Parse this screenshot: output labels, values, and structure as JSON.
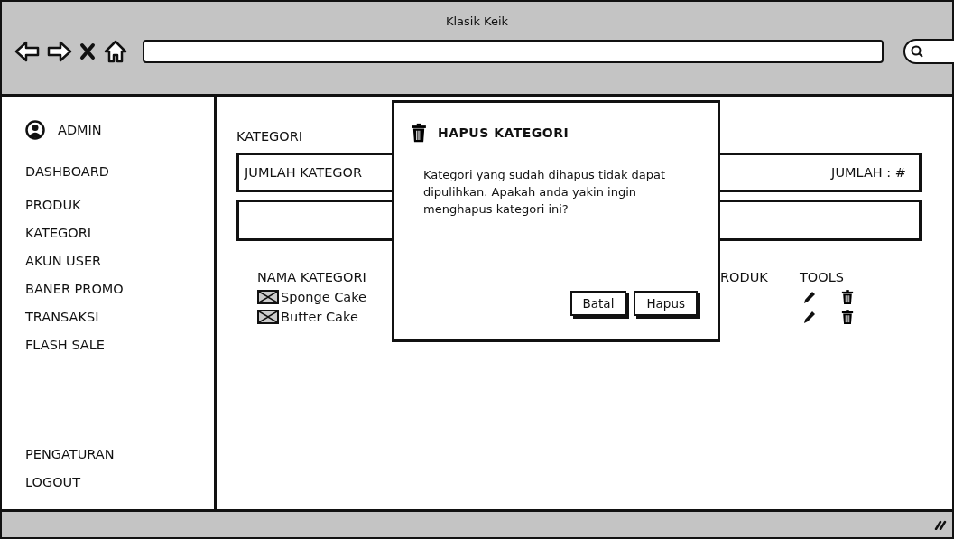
{
  "window": {
    "title": "Klasik Keik"
  },
  "sidebar": {
    "user": "ADMIN",
    "items": [
      "DASHBOARD",
      "PRODUK",
      "KATEGORI",
      "AKUN USER",
      "BANER PROMO",
      "TRANSAKSI",
      "FLASH SALE"
    ],
    "bottom_items": [
      "PENGATURAN",
      "LOGOUT"
    ]
  },
  "page": {
    "title": "KATEGORI",
    "summary_label": "JUMLAH KATEGOR",
    "summary_value": "JUMLAH : #",
    "table": {
      "columns": [
        "NAMA KATEGORI",
        "RODUK",
        "TOOLS"
      ],
      "rows": [
        {
          "name": "Sponge Cake"
        },
        {
          "name": "Butter Cake"
        }
      ]
    }
  },
  "dialog": {
    "title": "HAPUS KATEGORI",
    "message": "Kategori yang sudah dihapus tidak dapat dipulihkan. Apakah anda yakin ingin menghapus kategori ini?",
    "buttons": [
      "Batal",
      "Hapus"
    ]
  }
}
